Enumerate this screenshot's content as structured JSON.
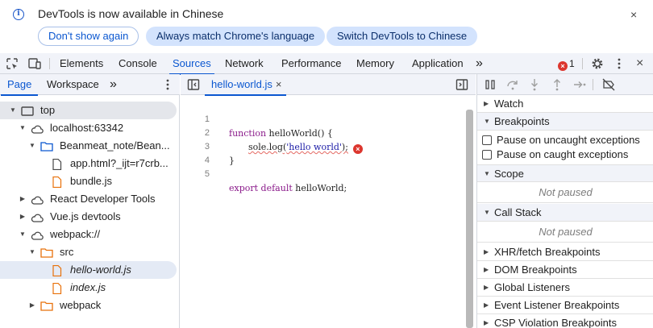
{
  "infobar": {
    "message": "DevTools is now available in Chinese",
    "btn_dont_show": "Don't show again",
    "btn_match_language": "Always match Chrome's language",
    "btn_switch_chinese": "Switch DevTools to Chinese",
    "close": "×",
    "info_glyph": "i"
  },
  "toolbar": {
    "tabs": [
      "Elements",
      "Console",
      "Sources",
      "Network",
      "Performance",
      "Memory",
      "Application"
    ],
    "active_tab": "Sources",
    "more_tabs": "»",
    "error_count": "1",
    "error_glyph": "×",
    "icons": [
      "inspect-element-icon",
      "device-toolbar-icon",
      "more-tabs-icon",
      "error-icon",
      "settings-gear-icon",
      "kebab-menu-icon",
      "close-icon"
    ],
    "close": "×"
  },
  "navigator": {
    "tabs": [
      "Page",
      "Workspace"
    ],
    "active_tab": "Page",
    "more": "»",
    "tree": [
      {
        "label": "top"
      },
      {
        "label": "localhost:63342"
      },
      {
        "label": "Beanmeat_note/Bean..."
      },
      {
        "label": "app.html?_ijt=r7crb..."
      },
      {
        "label": "bundle.js"
      },
      {
        "label": "React Developer Tools"
      },
      {
        "label": "Vue.js devtools"
      },
      {
        "label": "webpack://"
      },
      {
        "label": "src"
      },
      {
        "label": "hello-world.js"
      },
      {
        "label": "index.js"
      },
      {
        "label": "webpack"
      }
    ]
  },
  "editor": {
    "tab_label": "hello-world.js",
    "tab_close": "×",
    "lines": [
      {
        "num": "1",
        "kw": "function",
        "text": " helloWorld() {"
      },
      {
        "num": "2",
        "text": "sole.log(",
        "str": "'hello world'",
        "tail": ");",
        "error_glyph": "×"
      },
      {
        "num": "3",
        "text": "}"
      },
      {
        "num": "4",
        "text": ""
      },
      {
        "num": "5",
        "kw": "export default",
        "text": " helloWorld;"
      }
    ]
  },
  "debugger": {
    "sections": {
      "watch": "Watch",
      "breakpoints": "Breakpoints",
      "pause_uncaught": "Pause on uncaught exceptions",
      "pause_caught": "Pause on caught exceptions",
      "scope": "Scope",
      "scope_status": "Not paused",
      "call_stack": "Call Stack",
      "call_stack_status": "Not paused",
      "xhr": "XHR/fetch Breakpoints",
      "dom": "DOM Breakpoints",
      "global": "Global Listeners",
      "event": "Event Listener Breakpoints",
      "csp": "CSP Violation Breakpoints"
    }
  },
  "colors": {
    "accent": "#0b57d0",
    "error": "#dc362e",
    "toolbar_bg": "#f1f3f9",
    "folder": "#0b57d0",
    "file_orange": "#e8710a"
  }
}
